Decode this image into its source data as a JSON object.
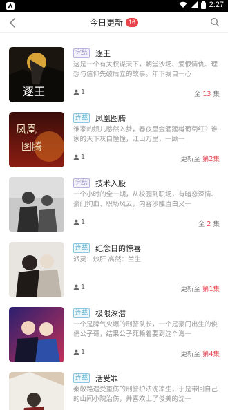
{
  "status": {
    "time": "2:27"
  },
  "header": {
    "title": "今日更新",
    "badge": "16"
  },
  "books": [
    {
      "tag": "完结",
      "tag_type": "done",
      "title": "逐王",
      "desc": "这是一个有关权谋天下，朝堂沙场、爱恨情仇、理想与信仰先破后立的故事。年下我自一心",
      "readers": "1",
      "count_prefix": "全",
      "count_value": "13",
      "count_suffix": "集"
    },
    {
      "tag": "连载",
      "tag_type": "ongoing",
      "title": "凤凰图腾",
      "desc": "谁家的娇儿憨然入梦，春夜里金酒狸樽葡萄红？谁家的天下灰自憧憧，江山万里，一顾一",
      "readers": "1",
      "count_prefix": "更新至",
      "count_value": "第2集",
      "count_suffix": ""
    },
    {
      "tag": "完结",
      "tag_type": "done",
      "title": "技术入股",
      "desc": "一个小时的全一期，从校园到职场，有暗恋深情、豪门狗血、职场风云，内容沙雕直白又一",
      "readers": "1",
      "count_prefix": "全",
      "count_value": "2",
      "count_suffix": "集"
    },
    {
      "tag": "连载",
      "tag_type": "ongoing",
      "title": "纪念日的惊喜",
      "desc": "派灵：炒肝 高然：兰生",
      "readers": "1",
      "count_prefix": "更新至",
      "count_value": "第1集",
      "count_suffix": ""
    },
    {
      "tag": "连载",
      "tag_type": "ongoing",
      "title": "极限深潜",
      "desc": "一个是脾气火爆的刑警队长，一个是豪门出生的俊俏公子哥，结果公子死赖着要到这个海一",
      "readers": "1",
      "count_prefix": "更新至",
      "count_value": "第4集",
      "count_suffix": ""
    },
    {
      "tag": "连载",
      "tag_type": "ongoing",
      "title": "活受罪",
      "desc": "秦敬路遇受重伤的刑警护法沈凉生，于是带回自己的山间小院治伤，并喜欢上了俊美的沈一",
      "readers": "",
      "count_prefix": "",
      "count_value": "",
      "count_suffix": ""
    }
  ]
}
